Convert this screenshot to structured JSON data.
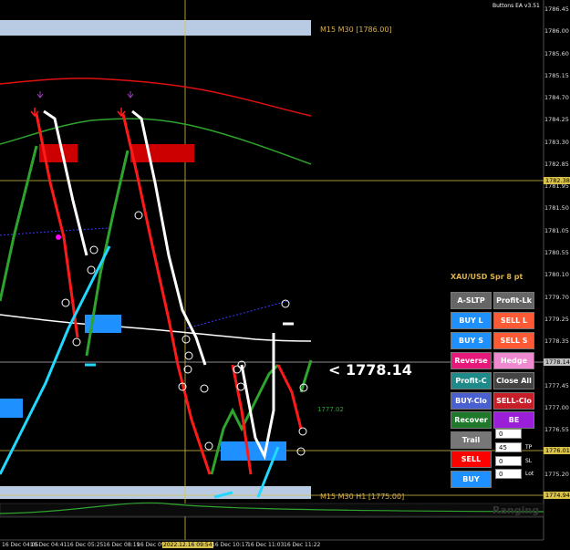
{
  "title": "Buttons EA v3.51",
  "colors": {
    "background": "#000000",
    "bull": "#2ea42e",
    "bear": "#ff1a1a",
    "zone_blue": "#1e90ff",
    "zone_red": "#cc0000",
    "current_price_line": "#bbbbbb"
  },
  "symbol_info": "XAU/USD Spr 8 pt",
  "big_price": "< 1778.14",
  "zone_labels": {
    "top": "M15 M30  [1786.00]",
    "bottom": "M15 M30 H1  [1775.00]"
  },
  "price_axis": [
    "1786.45",
    "1786.00",
    "1785.60",
    "1785.15",
    "1784.70",
    "1784.25",
    "1783.30",
    "1782.85",
    "1781.95",
    "1781.50",
    "1781.05",
    "1780.55",
    "1780.10",
    "1779.70",
    "1779.25",
    "1778.35",
    "1777.90",
    "1777.45",
    "1777.00",
    "1776.55",
    "1775.65",
    "1775.20",
    "1774.75"
  ],
  "price_tags": [
    {
      "label": "1782.38",
      "bg": "#d9c24b"
    },
    {
      "label": "1778.14",
      "bg": "#c0c0c0"
    },
    {
      "label": "1776.01",
      "bg": "#d9c24b"
    },
    {
      "label": "1774.94",
      "bg": "#d9c24b"
    }
  ],
  "time_axis": [
    "16 Dec 04:05",
    "16 Dec 04:41",
    "16 Dec 05:25",
    "16 Dec 08:19",
    "16 Dec 09",
    "2022.12.16 09:54",
    "16 Dec 10:17",
    "16 Dec 11:03",
    "16 Dec 11:22"
  ],
  "ma_label": "1777.02",
  "watermark": "Ranging",
  "buttons": [
    {
      "id": "a-sltp",
      "label": "A-SLTP",
      "bg": "#666666"
    },
    {
      "id": "profit-lk",
      "label": "Profit-Lk",
      "bg": "#666666"
    },
    {
      "id": "buy-l",
      "label": "BUY L",
      "bg": "#1e90ff"
    },
    {
      "id": "sell-l",
      "label": "SELL L",
      "bg": "#ff5a36"
    },
    {
      "id": "buy-s",
      "label": "BUY S",
      "bg": "#1e90ff"
    },
    {
      "id": "sell-s",
      "label": "SELL S",
      "bg": "#ff5a36"
    },
    {
      "id": "reverse",
      "label": "Reverse",
      "bg": "#e6197a"
    },
    {
      "id": "hedge",
      "label": "Hedge",
      "bg": "#f08ad0"
    },
    {
      "id": "profit-c",
      "label": "Profit-C",
      "bg": "#1f8a8a"
    },
    {
      "id": "close-all",
      "label": "Close All",
      "bg": "#444444"
    },
    {
      "id": "buy-clo",
      "label": "BUY-Clo",
      "bg": "#4a5fd0"
    },
    {
      "id": "sell-clo",
      "label": "SELL-Clo",
      "bg": "#c81e2a"
    },
    {
      "id": "recover",
      "label": "Recover",
      "bg": "#1e7a2a"
    },
    {
      "id": "be",
      "label": "BE",
      "bg": "#9b1ed8"
    },
    {
      "id": "trail",
      "label": "Trail",
      "bg": "#777777"
    },
    {
      "id": "sell",
      "label": "SELL",
      "bg": "#ff0000"
    },
    {
      "id": "buy",
      "label": "BUY",
      "bg": "#1e90ff"
    }
  ],
  "fields": [
    {
      "value": "0",
      "label": ""
    },
    {
      "value": "45",
      "label": "TP"
    },
    {
      "value": "0",
      "label": "SL"
    },
    {
      "value": "0",
      "label": "Lot"
    }
  ]
}
